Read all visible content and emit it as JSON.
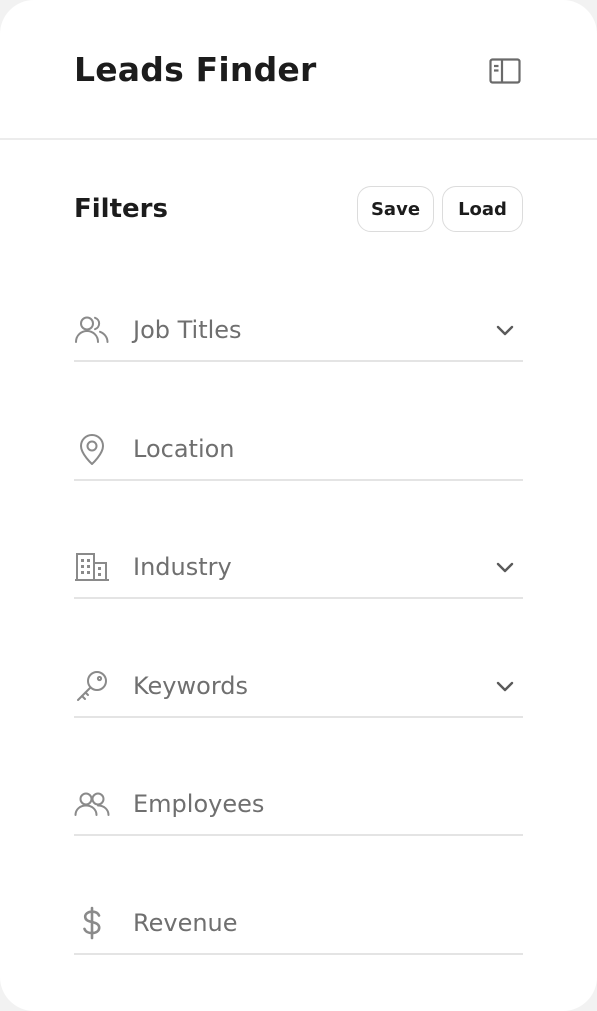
{
  "app": {
    "title": "Leads Finder",
    "sidebar_toggle_icon": "sidebar-panel-icon"
  },
  "filters": {
    "title": "Filters",
    "save_label": "Save",
    "load_label": "Load",
    "fields": [
      {
        "label": "Job Titles",
        "icon": "people-icon",
        "has_dropdown": true
      },
      {
        "label": "Location",
        "icon": "location-pin-icon",
        "has_dropdown": false
      },
      {
        "label": "Industry",
        "icon": "building-icon",
        "has_dropdown": true
      },
      {
        "label": "Keywords",
        "icon": "key-icon",
        "has_dropdown": true
      },
      {
        "label": "Employees",
        "icon": "people-icon",
        "has_dropdown": false
      },
      {
        "label": "Revenue",
        "icon": "dollar-icon",
        "has_dropdown": false
      }
    ]
  },
  "colors": {
    "text_primary": "#1c1c1c",
    "text_muted": "#6f6f6f",
    "icon": "#8a8a8a",
    "divider": "#e4e4e4",
    "button_border": "#dcdcdc"
  }
}
